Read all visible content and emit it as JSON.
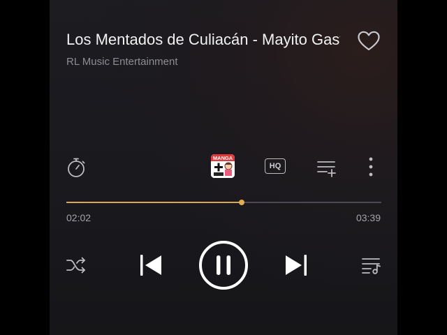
{
  "song": {
    "title": "Los Mentados de Culiacán - Mayito Gastelum",
    "artist": "RL Music Entertainment"
  },
  "controls": {
    "hq_label": "HQ",
    "badge_text": "MANGA"
  },
  "progress": {
    "current": "02:02",
    "total": "03:39",
    "fraction": 0.557
  },
  "icons": [
    "heart-icon",
    "timer-icon",
    "manga-app-icon",
    "hq-icon",
    "add-to-queue-icon",
    "more-icon",
    "shuffle-icon",
    "previous-icon",
    "pause-icon",
    "next-icon",
    "playlist-icon"
  ],
  "colors": {
    "accent": "#d9a84e",
    "text_primary": "#f2f2f2",
    "text_secondary": "#8d8d93"
  }
}
